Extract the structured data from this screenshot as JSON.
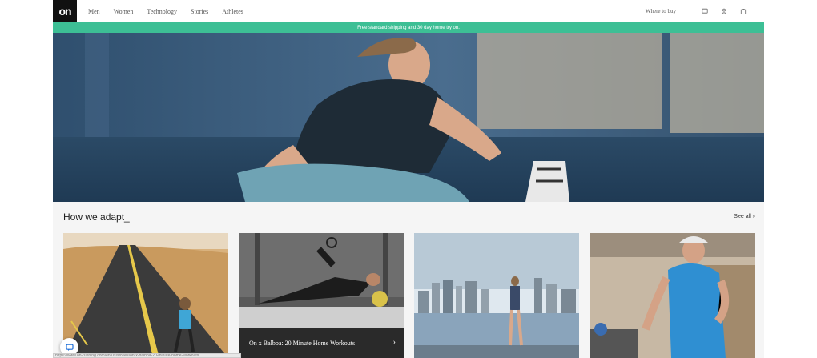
{
  "header": {
    "logo_text": "on",
    "nav": [
      "Men",
      "Women",
      "Technology",
      "Stories",
      "Athletes"
    ],
    "where_to_buy": "Where to buy",
    "icons": [
      "globe-icon",
      "user-icon",
      "bag-icon"
    ]
  },
  "promo": {
    "text": "Free standard shipping and 30 day home try on."
  },
  "section": {
    "title": "How we adapt_",
    "see_all": "See all",
    "cards": [
      {
        "caption": ""
      },
      {
        "caption": "On x Balboa: 20 Minute Home Workouts"
      },
      {
        "caption": ""
      },
      {
        "caption": ""
      }
    ]
  },
  "status_bar": {
    "text": "https://www.on-running.com/en-us/stories/on-x-balboa-20-minute-home-workouts"
  },
  "colors": {
    "promo": "#3dbf95",
    "logo_bg": "#111111",
    "caption_bg": "#2a2a2a"
  }
}
